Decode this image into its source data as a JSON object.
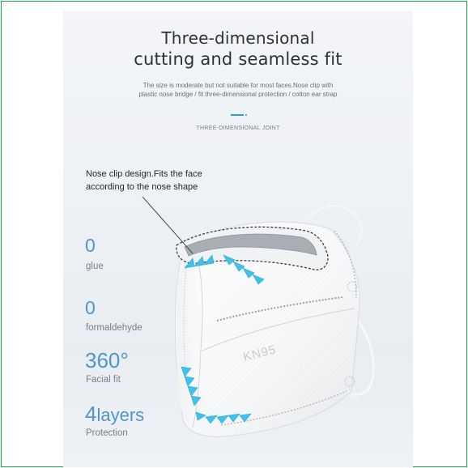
{
  "header": {
    "title_line1": "Three-dimensional",
    "title_line2": "cutting and seamless fit",
    "subtitle_line1": "The size is moderate but not suitable for most faces.Nose clip with",
    "subtitle_line2": "plastic nose bridge / fit three-dimensional protection / cotton ear strap",
    "section_label": "THREE-DIMENSIONAL JOINT"
  },
  "annotation": {
    "line1": "Nose clip design.Fits the face",
    "line2": "according to the nose shape"
  },
  "features": [
    {
      "value": "0",
      "label": "glue"
    },
    {
      "value": "0",
      "label": "formaldehyde"
    },
    {
      "value": "360°",
      "label": "Facial fit"
    },
    {
      "value_number": "4",
      "value_unit": "layers",
      "label": "Protection"
    }
  ],
  "product": {
    "mask_print": "KN95"
  },
  "colors": {
    "border": "#1aa84b",
    "accent_blue": "#4f96cc",
    "arrow_cyan": "#3ec3ee",
    "nose_clip": "#9aa0a8",
    "title": "#2c3138"
  }
}
